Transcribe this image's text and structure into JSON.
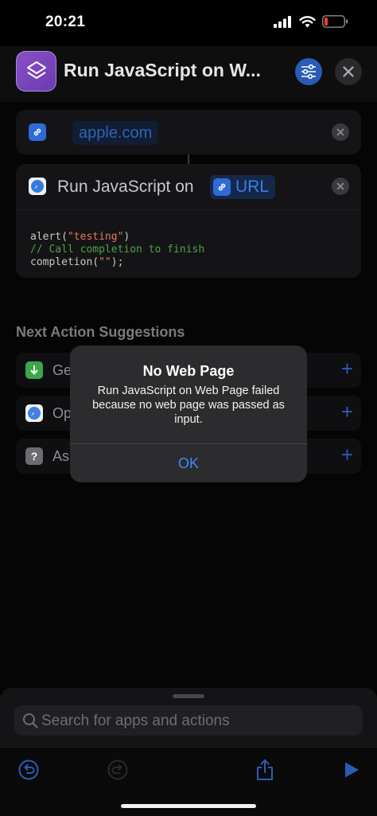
{
  "status_bar": {
    "time": "20:21"
  },
  "header": {
    "title": "Run JavaScript on W..."
  },
  "url_action": {
    "value": "apple.com"
  },
  "js_action": {
    "title": "Run JavaScript on",
    "input_label": "URL",
    "code_lines": [
      {
        "prefix": "alert(",
        "string": "\"testing\"",
        "suffix": ")"
      },
      {
        "comment": "// Call completion to finish"
      },
      {
        "prefix": "completion(",
        "string": "\"\"",
        "suffix": ");"
      }
    ]
  },
  "suggestions": {
    "heading": "Next Action Suggestions",
    "items": [
      {
        "label": "Ge",
        "icon": "download-icon",
        "color": "#3aa74a"
      },
      {
        "label": "Op",
        "icon": "safari-icon",
        "color": "#3b82e6"
      },
      {
        "label": "As",
        "icon": "question-icon",
        "color": "#6b6b70"
      }
    ]
  },
  "alert": {
    "title": "No Web Page",
    "message": "Run JavaScript on Web Page failed because no web page was passed as input.",
    "ok_label": "OK"
  },
  "search": {
    "placeholder": "Search for apps and actions"
  },
  "colors": {
    "accent": "#3d8bf5",
    "shortcut_purple": "#8b4fc8"
  }
}
